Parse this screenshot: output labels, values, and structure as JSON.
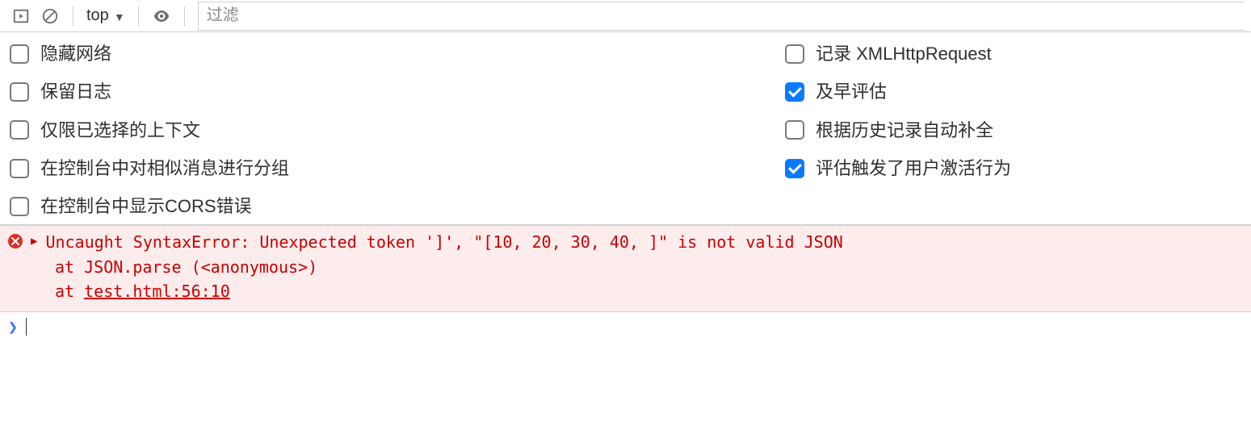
{
  "toolbar": {
    "contextLabel": "top",
    "filterPlaceholder": "过滤"
  },
  "settings": {
    "left": [
      {
        "label": "隐藏网络",
        "checked": false
      },
      {
        "label": "保留日志",
        "checked": false
      },
      {
        "label": "仅限已选择的上下文",
        "checked": false
      },
      {
        "label": "在控制台中对相似消息进行分组",
        "checked": false
      },
      {
        "label": "在控制台中显示CORS错误",
        "checked": false
      }
    ],
    "right": [
      {
        "label": "记录 XMLHttpRequest",
        "checked": false
      },
      {
        "label": "及早评估",
        "checked": true
      },
      {
        "label": "根据历史记录自动补全",
        "checked": false
      },
      {
        "label": "评估触发了用户激活行为",
        "checked": true
      }
    ]
  },
  "error": {
    "message": "Uncaught SyntaxError: Unexpected token ']', \"[10, 20, 30, 40, ]\" is not valid JSON",
    "stack1_prefix": "at JSON.parse (",
    "stack1_link": "<anonymous>",
    "stack1_suffix": ")",
    "stack2_prefix": "at ",
    "stack2_link": "test.html:56:10"
  },
  "prompt": {
    "symbol": "❯"
  }
}
